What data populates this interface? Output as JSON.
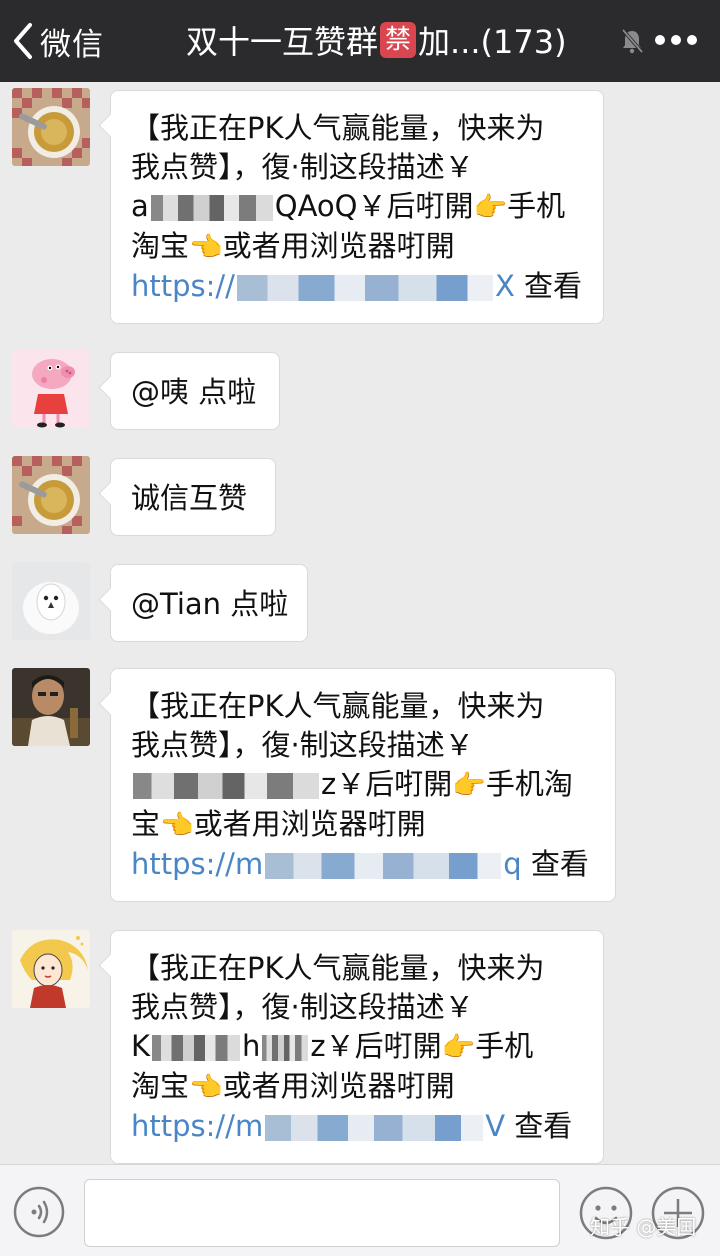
{
  "header": {
    "back_label": "微信",
    "title_prefix": "双十一互赞群",
    "ban_badge": "禁",
    "title_suffix": "加...(173)"
  },
  "messages": [
    {
      "lines": [
        {
          "text": "【我正在PK人气赢能量，快来为"
        },
        {
          "text": "我点赞】，復·制这段描述￥"
        },
        {
          "pre": "a",
          "mid": "QAoQ",
          "post": "￥后咑開"
        },
        {
          "text": "淘宝",
          "after": "或者用浏览器咑開"
        },
        {
          "link": "https://",
          "link_tail": "X",
          "view": "查看"
        }
      ],
      "emoji_a": "👉",
      "line3_tail": "手机",
      "emoji_b": "👈"
    },
    {
      "text": "@咦 点啦"
    },
    {
      "text": "诚信互赞"
    },
    {
      "text": "@Tian 点啦"
    },
    {
      "line1": "【我正在PK人气赢能量，快来为",
      "line2": "我点赞】，復·制这段描述￥",
      "line3_mid": "z￥后咑開",
      "line3_tail": "手机淘",
      "line4_head": "宝",
      "line4_tail": "或者用浏览器咑開",
      "link": "https://m",
      "link_tail": "q",
      "view": "查看"
    },
    {
      "line1": "【我正在PK人气赢能量，快来为",
      "line2": "我点赞】，復·制这段描述￥",
      "line3_head": "K",
      "line3_mid": "h",
      "line3_post": "z￥后咑開",
      "line3_tail": "手机",
      "line4_head": "淘宝",
      "line4_tail": "或者用浏览器咑開",
      "link": "https://m",
      "link_tail": "V",
      "view": "查看"
    }
  ],
  "emoji": {
    "point_right": "👉",
    "point_left": "👈"
  },
  "input": {
    "placeholder": ""
  },
  "watermark": "知乎 @美国"
}
